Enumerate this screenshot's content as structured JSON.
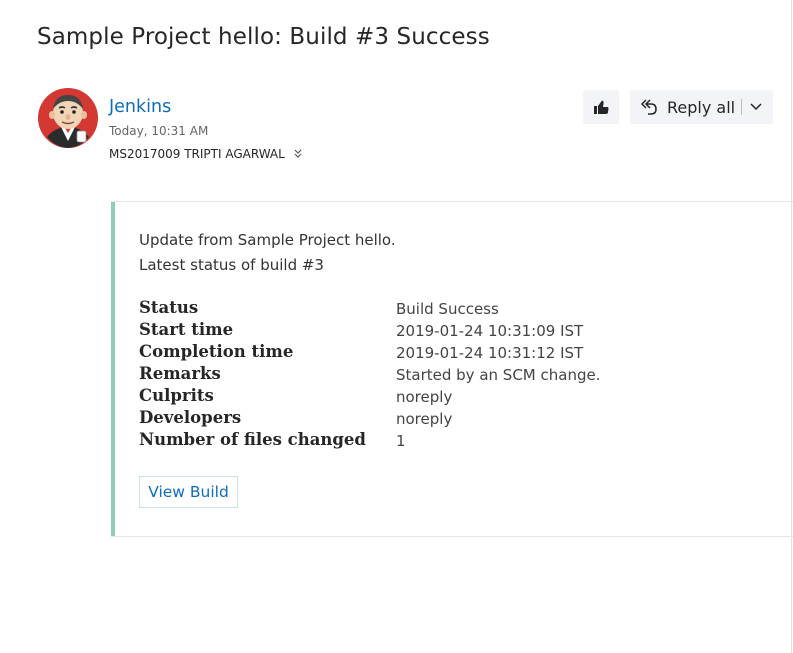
{
  "message": {
    "subject": "Sample Project hello: Build #3 Success",
    "sender": {
      "name": "Jenkins",
      "avatar_icon": "jenkins-butler-icon"
    },
    "time": "Today, 10:31 AM",
    "recipient": "MS2017009 TRIPTI AGARWAL"
  },
  "actions": {
    "like_icon": "thumbs-up-icon",
    "reply_all_label": "Reply all",
    "reply_icon": "reply-all-icon",
    "more_icon": "chevron-down-icon"
  },
  "body": {
    "intro_line1": "Update from Sample Project hello.",
    "intro_line2": "Latest status of build #3",
    "rows": [
      {
        "label": "Status",
        "value": "Build Success"
      },
      {
        "label": "Start time",
        "value": "2019-01-24 10:31:09 IST"
      },
      {
        "label": "Completion time",
        "value": "2019-01-24 10:31:12 IST"
      },
      {
        "label": "Remarks",
        "value": "Started by an SCM change."
      },
      {
        "label": "Culprits",
        "value": "noreply"
      },
      {
        "label": "Developers",
        "value": "noreply"
      },
      {
        "label": "Number of files changed",
        "value": "1"
      }
    ],
    "button_label": "View Build",
    "accent_color": "#8fcfb5"
  }
}
